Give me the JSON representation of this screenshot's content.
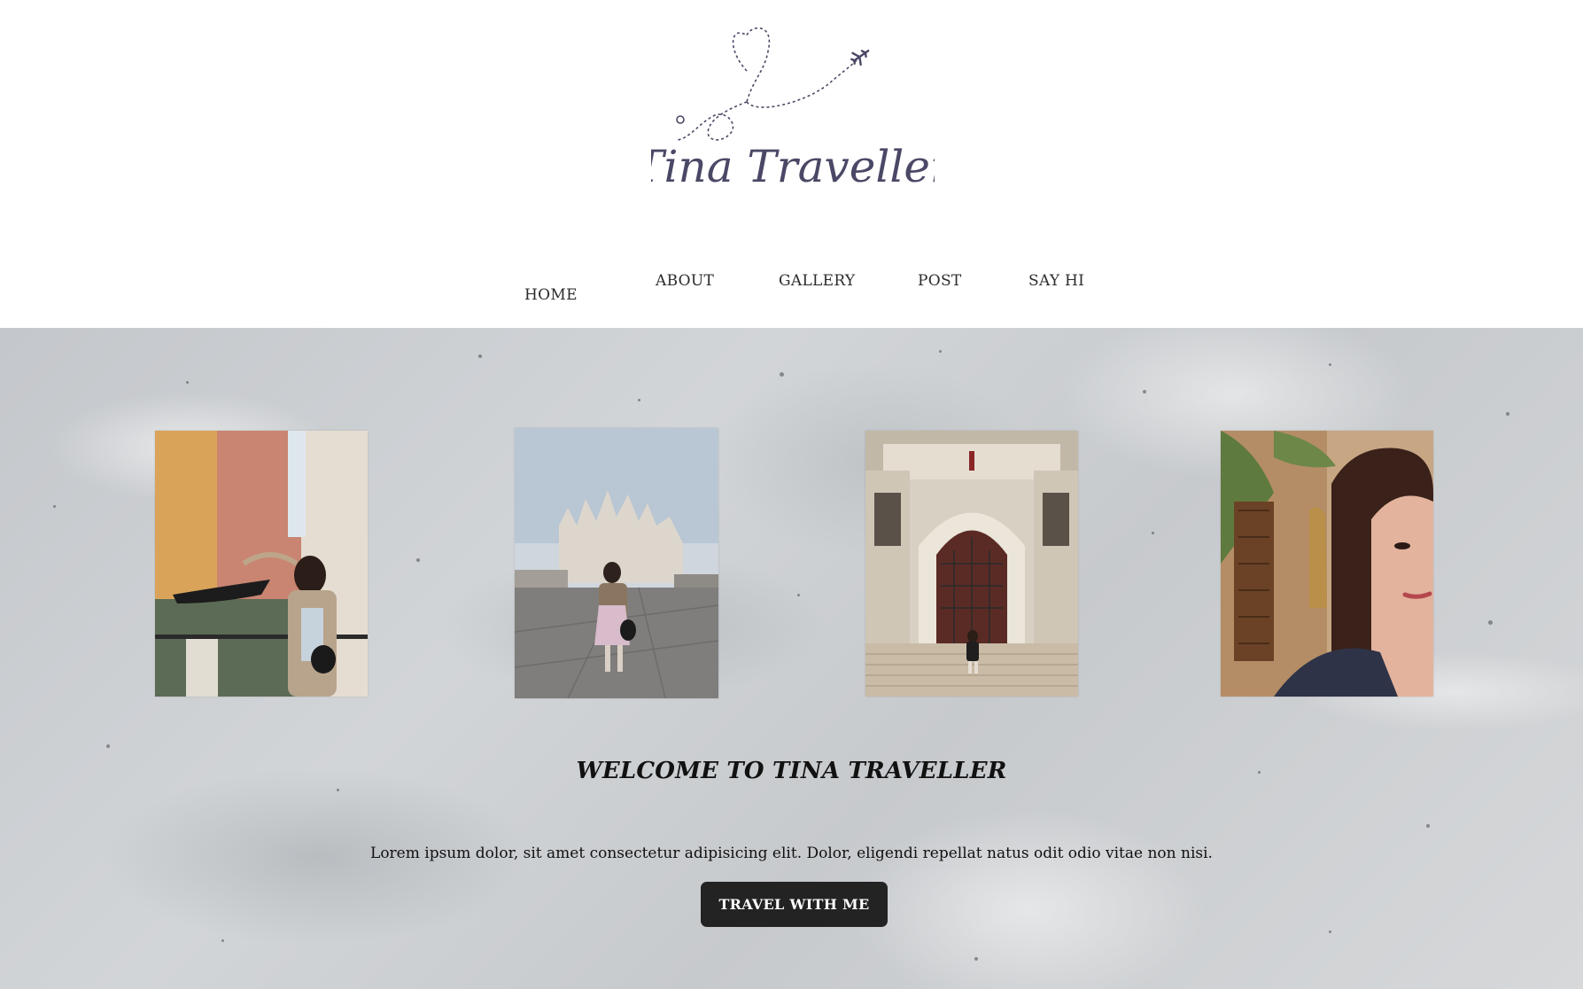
{
  "brand": {
    "logo_text": "Tina Traveller",
    "logo_icons": [
      "heart-icon",
      "airplane-icon",
      "location-pin-icon"
    ],
    "logo_color": "#4a4866"
  },
  "nav": {
    "items": [
      {
        "label": "HOME"
      },
      {
        "label": "ABOUT"
      },
      {
        "label": "GALLERY"
      },
      {
        "label": "POST"
      },
      {
        "label": "SAY HI"
      }
    ]
  },
  "hero": {
    "photos": [
      {
        "subject": "venice-canal"
      },
      {
        "subject": "milan-cathedral"
      },
      {
        "subject": "palace-doorway"
      },
      {
        "subject": "selfie-courtyard"
      }
    ],
    "heading": "WELCOME TO TINA TRAVELLER",
    "body": "Lorem ipsum dolor, sit amet consectetur adipisicing elit. Dolor, eligendi repellat natus odit odio vitae non nisi.",
    "cta_label": "TRAVEL WITH ME",
    "cta_color": "#232323"
  }
}
